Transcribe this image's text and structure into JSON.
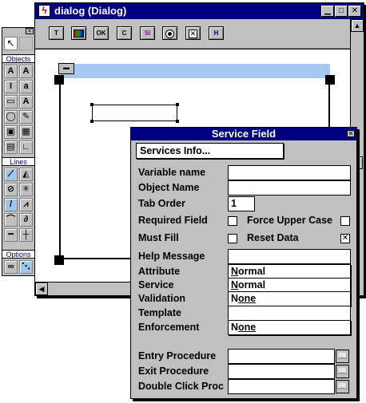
{
  "dialog": {
    "title": "dialog  (Dialog)",
    "toolbar": [
      "T",
      "",
      "OK",
      "C",
      "SI",
      "",
      "",
      "H"
    ]
  },
  "palette": {
    "sections": [
      "Objects",
      "Lines",
      "Options"
    ]
  },
  "service_field": {
    "title": "Service Field",
    "services_info": "Services Info...",
    "labels": {
      "variable_name": "Variable name",
      "object_name": "Object Name",
      "tab_order": "Tab Order",
      "required_field": "Required Field",
      "force_upper_case": "Force Upper Case",
      "must_fill": "Must Fill",
      "reset_data": "Reset Data",
      "help_message": "Help Message",
      "attribute": "Attribute",
      "service": "Service",
      "validation": "Validation",
      "template": "Template",
      "enforcement": "Enforcement",
      "entry_procedure": "Entry Procedure",
      "exit_procedure": "Exit Procedure",
      "double_click_proc": "Double Click Proc"
    },
    "values": {
      "variable_name": "",
      "object_name": "",
      "tab_order": "1",
      "help_message": "",
      "attribute_n": "N",
      "attribute_rest": "ormal",
      "service_n": "N",
      "service_rest": "ormal",
      "validation_n": "N",
      "validation_rest": "one",
      "template": "",
      "enforcement_n": "N",
      "enforcement_rest": "one",
      "entry_procedure": "",
      "exit_procedure": "",
      "double_click_proc": ""
    },
    "checks": {
      "required_field": false,
      "force_upper_case": false,
      "must_fill": false,
      "reset_data": true
    }
  }
}
